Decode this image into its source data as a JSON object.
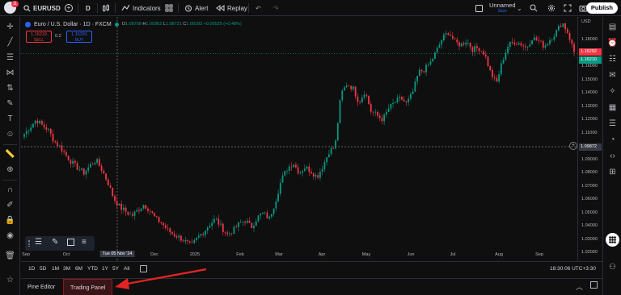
{
  "topbar": {
    "badge": "11",
    "symbol": "EURUSD",
    "interval": "D",
    "indicators": "Indicators",
    "alert": "Alert",
    "replay": "Replay",
    "layout_name": "Unnamed",
    "layout_sub": "Save",
    "publish": "Publish"
  },
  "legend": {
    "title": "Euro / U.S. Dollar · 1D · FXCM",
    "open_l": "O",
    "open": "1.08768",
    "high_l": "H",
    "high": "1.09362",
    "low_l": "L",
    "low": "1.08721",
    "close_l": "C",
    "close": "1.09293",
    "change": "+0.00525 (+0.48%)"
  },
  "trade": {
    "sell_price": "1.16219",
    "sell_label": "SELL",
    "spread": "0.2",
    "buy_price": "1.16291",
    "buy_label": "BUY"
  },
  "price_axis": {
    "currency": "USD",
    "labels": [
      "1.18000",
      "1.17000",
      "1.16000",
      "1.15000",
      "1.14000",
      "1.13000",
      "1.12000",
      "1.11000",
      "1.10000",
      "1.09000",
      "1.08000",
      "1.07000",
      "1.06000",
      "1.05000",
      "1.04000",
      "1.03000",
      "1.02000"
    ],
    "last_price": "1.16210",
    "last_price_alt": "1.16292",
    "crosshair_price": "1.09872"
  },
  "time_axis": {
    "labels": [
      "Sep",
      "Oct",
      "Tue 05 Nov '24",
      "Dec",
      "2025",
      "Feb",
      "Mar",
      "Apr",
      "May",
      "Jun",
      "Jul",
      "Aug",
      "Sep"
    ]
  },
  "timeframes": [
    "1D",
    "5D",
    "1M",
    "3M",
    "6M",
    "YTD",
    "1Y",
    "5Y",
    "All"
  ],
  "clock": "18:30:06 UTC+3:30",
  "bottom": {
    "pine_editor": "Pine Editor",
    "trading_panel": "Trading Panel"
  },
  "colors": {
    "up": "#089981",
    "down": "#f23645",
    "annotation_arrow": "#e02424"
  },
  "chart_data": {
    "type": "candlestick",
    "symbol": "EURUSD",
    "interval": "1D",
    "ylim": [
      1.0175,
      1.1875
    ],
    "x_start": "2024-09",
    "x_end": "2025-09",
    "close_path": [
      1.106,
      1.111,
      1.116,
      1.112,
      1.109,
      1.101,
      1.097,
      1.091,
      1.086,
      1.082,
      1.079,
      1.084,
      1.088,
      1.081,
      1.072,
      1.061,
      1.055,
      1.052,
      1.049,
      1.053,
      1.057,
      1.053,
      1.047,
      1.044,
      1.039,
      1.036,
      1.034,
      1.031,
      1.028,
      1.034,
      1.038,
      1.043,
      1.047,
      1.041,
      1.036,
      1.039,
      1.044,
      1.046,
      1.041,
      1.048,
      1.051,
      1.047,
      1.059,
      1.074,
      1.082,
      1.086,
      1.079,
      1.083,
      1.08,
      1.076,
      1.084,
      1.094,
      1.097,
      1.134,
      1.141,
      1.138,
      1.128,
      1.136,
      1.122,
      1.119,
      1.116,
      1.124,
      1.128,
      1.131,
      1.127,
      1.135,
      1.149,
      1.151,
      1.156,
      1.164,
      1.173,
      1.177,
      1.17,
      1.168,
      1.171,
      1.165,
      1.166,
      1.162,
      1.149,
      1.141,
      1.157,
      1.168,
      1.17,
      1.169,
      1.166,
      1.173,
      1.171,
      1.167,
      1.172,
      1.177,
      1.184,
      1.176,
      1.163
    ]
  }
}
